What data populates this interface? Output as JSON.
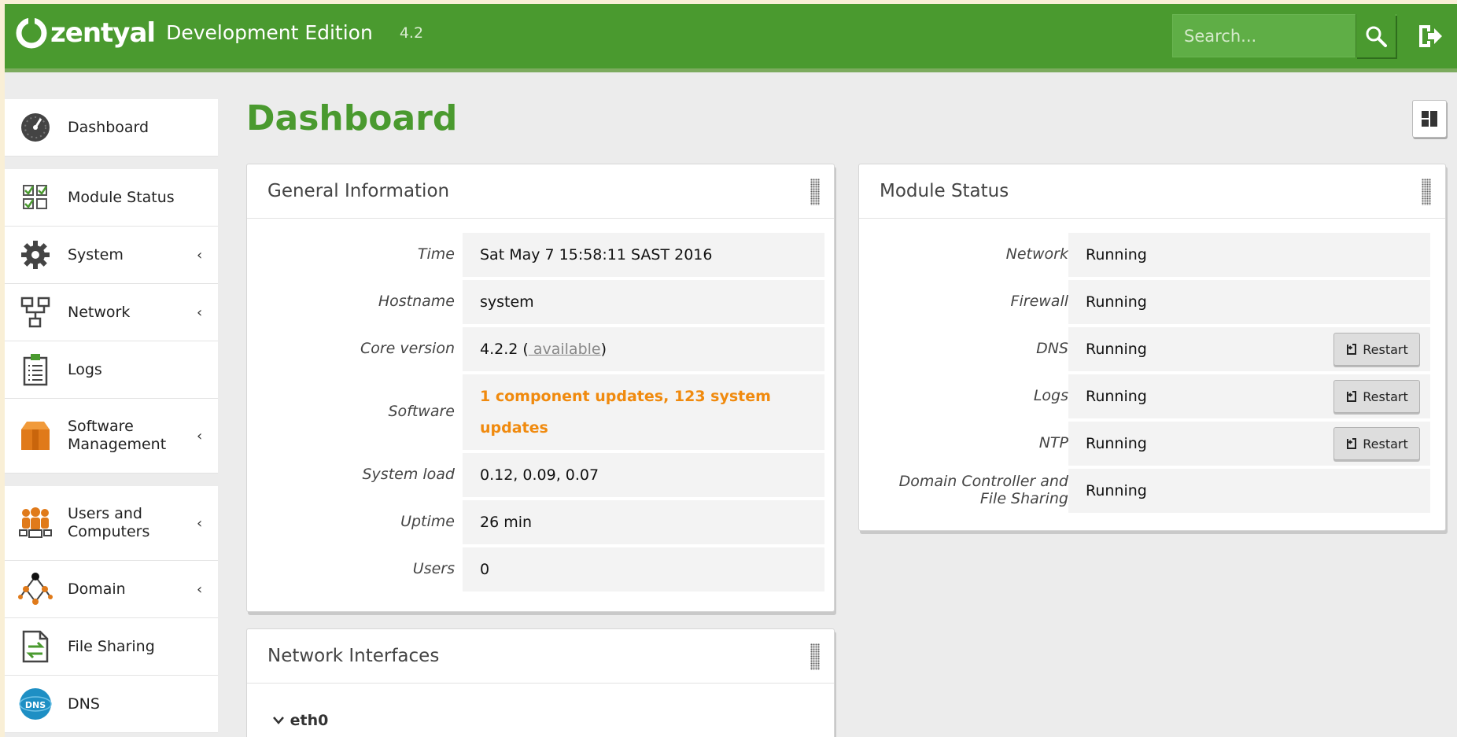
{
  "header": {
    "brand": "zentyal",
    "edition": "Development Edition",
    "version": "4.2",
    "search_placeholder": "Search...",
    "colors": {
      "bar": "#4a9a2f",
      "title": "#4a9a2f",
      "accent_orange": "#f08a0e"
    }
  },
  "sidebar": {
    "items": [
      {
        "label": "Dashboard",
        "icon": "dashboard-gauge-icon",
        "chevron": ""
      },
      {
        "label": "Module Status",
        "icon": "checkbox-grid-icon",
        "chevron": ""
      },
      {
        "label": "System",
        "icon": "gear-icon",
        "chevron": "‹"
      },
      {
        "label": "Network",
        "icon": "network-icon",
        "chevron": "‹"
      },
      {
        "label": "Logs",
        "icon": "clipboard-icon",
        "chevron": ""
      },
      {
        "label": "Software Management",
        "icon": "package-box-icon",
        "chevron": "‹"
      },
      {
        "label": "Users and Computers",
        "icon": "users-icon",
        "chevron": "‹"
      },
      {
        "label": "Domain",
        "icon": "domain-tree-icon",
        "chevron": "‹"
      },
      {
        "label": "File Sharing",
        "icon": "file-sharing-icon",
        "chevron": ""
      },
      {
        "label": "DNS",
        "icon": "dns-icon",
        "chevron": ""
      }
    ]
  },
  "page": {
    "title": "Dashboard"
  },
  "general_info": {
    "title": "General Information",
    "rows": [
      {
        "key": "Time",
        "value": "Sat May 7 15:58:11 SAST 2016"
      },
      {
        "key": "Hostname",
        "value": "system"
      },
      {
        "key": "Core version",
        "value": "4.2.2 (",
        "link": " available",
        "suffix": ")"
      },
      {
        "key": "Software",
        "value": "1 component updates, 123 system updates"
      },
      {
        "key": "System load",
        "value": "0.12, 0.09, 0.07"
      },
      {
        "key": "Uptime",
        "value": "26 min"
      },
      {
        "key": "Users",
        "value": "0"
      }
    ]
  },
  "module_status": {
    "title": "Module Status",
    "restart_label": "Restart",
    "rows": [
      {
        "key": "Network",
        "value": "Running",
        "restart": false
      },
      {
        "key": "Firewall",
        "value": "Running",
        "restart": false
      },
      {
        "key": "DNS",
        "value": "Running",
        "restart": true
      },
      {
        "key": "Logs",
        "value": "Running",
        "restart": true
      },
      {
        "key": "NTP",
        "value": "Running",
        "restart": true
      },
      {
        "key": "Domain Controller and File Sharing",
        "value": "Running",
        "restart": false
      }
    ]
  },
  "network_interfaces": {
    "title": "Network Interfaces",
    "interfaces": [
      {
        "name": "eth0"
      }
    ]
  }
}
